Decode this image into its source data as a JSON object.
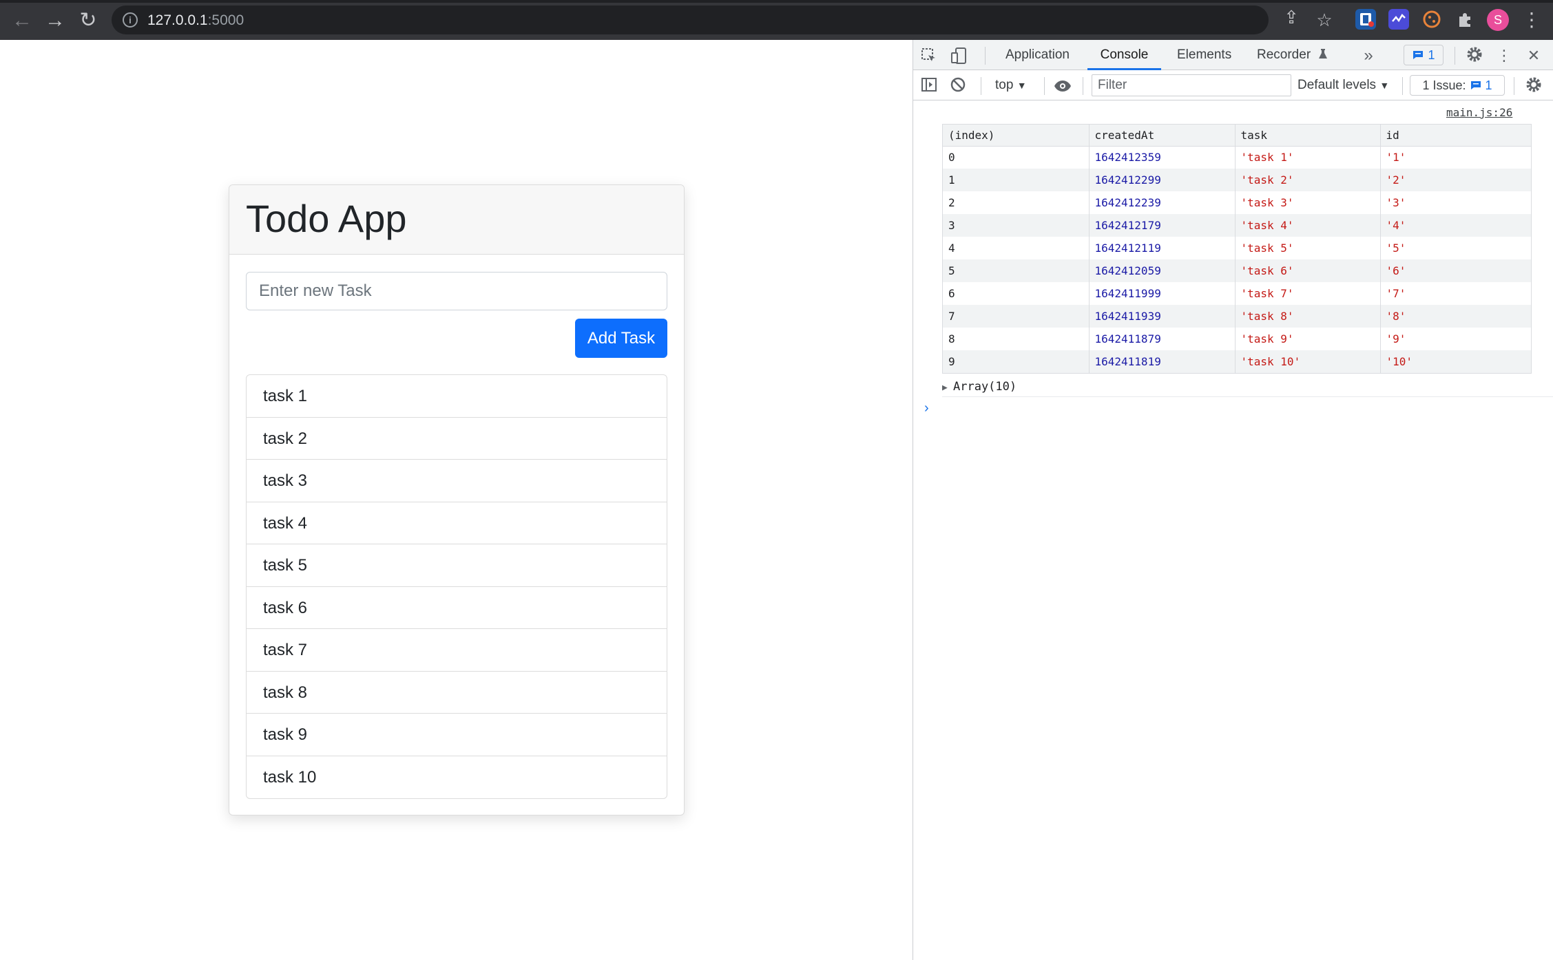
{
  "browser": {
    "back_icon": "←",
    "forward_icon": "→",
    "reload_icon": "↻",
    "info_icon": "i",
    "url_host": "127.0.0.1",
    "url_port": ":5000",
    "share_icon": "⇪",
    "star_icon": "☆",
    "avatar_initial": "S",
    "menu_icon": "⋮"
  },
  "app": {
    "title": "Todo App",
    "input_placeholder": "Enter new Task",
    "add_button": "Add Task",
    "tasks": [
      "task 1",
      "task 2",
      "task 3",
      "task 4",
      "task 5",
      "task 6",
      "task 7",
      "task 8",
      "task 9",
      "task 10"
    ]
  },
  "devtools": {
    "tabs": [
      "Application",
      "Console",
      "Elements",
      "Recorder"
    ],
    "active_tab": "Console",
    "more_tabs_icon": "»",
    "message_count": "1",
    "context": "top",
    "filter_placeholder": "Filter",
    "levels": "Default levels",
    "issues_label": "1 Issue:",
    "issues_count": "1",
    "source_link": "main.js:26",
    "columns": [
      "(index)",
      "createdAt",
      "task",
      "id"
    ],
    "rows": [
      {
        "index": "0",
        "createdAt": "1642412359",
        "task": "'task 1'",
        "id": "'1'"
      },
      {
        "index": "1",
        "createdAt": "1642412299",
        "task": "'task 2'",
        "id": "'2'"
      },
      {
        "index": "2",
        "createdAt": "1642412239",
        "task": "'task 3'",
        "id": "'3'"
      },
      {
        "index": "3",
        "createdAt": "1642412179",
        "task": "'task 4'",
        "id": "'4'"
      },
      {
        "index": "4",
        "createdAt": "1642412119",
        "task": "'task 5'",
        "id": "'5'"
      },
      {
        "index": "5",
        "createdAt": "1642412059",
        "task": "'task 6'",
        "id": "'6'"
      },
      {
        "index": "6",
        "createdAt": "1642411999",
        "task": "'task 7'",
        "id": "'7'"
      },
      {
        "index": "7",
        "createdAt": "1642411939",
        "task": "'task 8'",
        "id": "'8'"
      },
      {
        "index": "8",
        "createdAt": "1642411879",
        "task": "'task 9'",
        "id": "'9'"
      },
      {
        "index": "9",
        "createdAt": "1642411819",
        "task": "'task 10'",
        "id": "'10'"
      }
    ],
    "array_summary": "Array(10)",
    "prompt_icon": "›"
  },
  "colors": {
    "primary_button": "#0d6efd",
    "browser_chrome": "#35363a",
    "devtools_active": "#1a73e8",
    "number_value": "#1a1aa6",
    "string_value": "#c41a16"
  }
}
